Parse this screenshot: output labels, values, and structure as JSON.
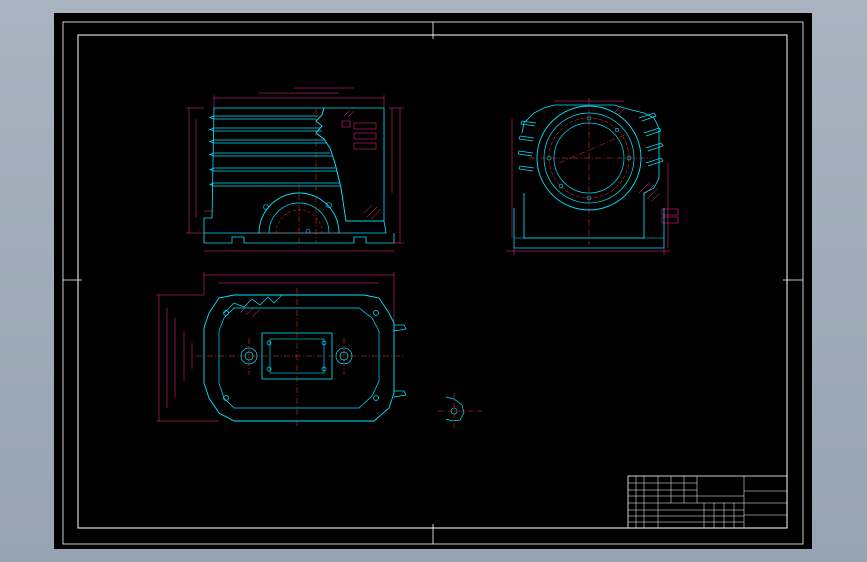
{
  "drawing": {
    "scale_note": "",
    "notes_title": "",
    "notes": [
      "",
      "",
      "",
      "",
      ""
    ]
  },
  "title_block": {
    "school": "",
    "part_name": "",
    "drawing_no": ""
  },
  "colors": {
    "background": "#000000",
    "frame": "#ffffff",
    "outline": "#00e5ff",
    "dimension": "#ff2a8a",
    "center_line": "#ff3333"
  }
}
